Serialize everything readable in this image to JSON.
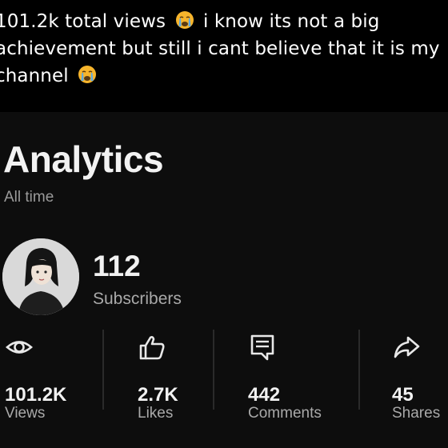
{
  "caption": {
    "line1_text": "101.2k total views",
    "line1_rest": "i know its not a big",
    "line2": "achievement but still i cant believe that it is my",
    "line3": "channel",
    "emoji": "crying-face-emoji"
  },
  "analytics": {
    "title": "Analytics",
    "period": "All time"
  },
  "channel": {
    "subscribers_count": "112",
    "subscribers_label": "Subscribers"
  },
  "stats": [
    {
      "icon": "eye-icon",
      "value": "101.2K",
      "label": "Views"
    },
    {
      "icon": "thumbs-up-icon",
      "value": "2.7K",
      "label": "Likes"
    },
    {
      "icon": "comment-icon",
      "value": "442",
      "label": "Comments"
    },
    {
      "icon": "share-icon",
      "value": "45",
      "label": "Shares"
    }
  ],
  "colors": {
    "background": "#000000",
    "panel": "#0d0d0d",
    "primary_text": "#f1f1f1",
    "secondary_text": "#a9a9a9",
    "emoji_yellow": "#f7b52c",
    "emoji_tear": "#5aa9e6"
  }
}
